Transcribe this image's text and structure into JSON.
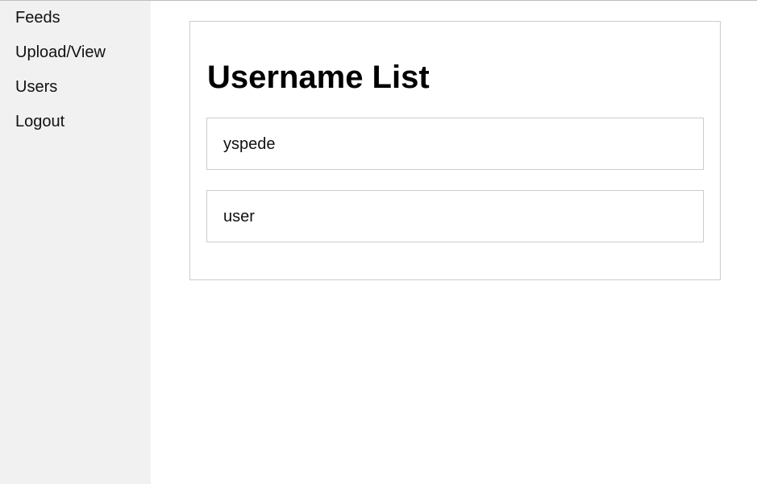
{
  "sidebar": {
    "items": [
      {
        "label": "Feeds"
      },
      {
        "label": "Upload/View"
      },
      {
        "label": "Users"
      },
      {
        "label": "Logout"
      }
    ]
  },
  "main": {
    "title": "Username List",
    "users": [
      {
        "username": "yspede"
      },
      {
        "username": "user"
      }
    ]
  }
}
